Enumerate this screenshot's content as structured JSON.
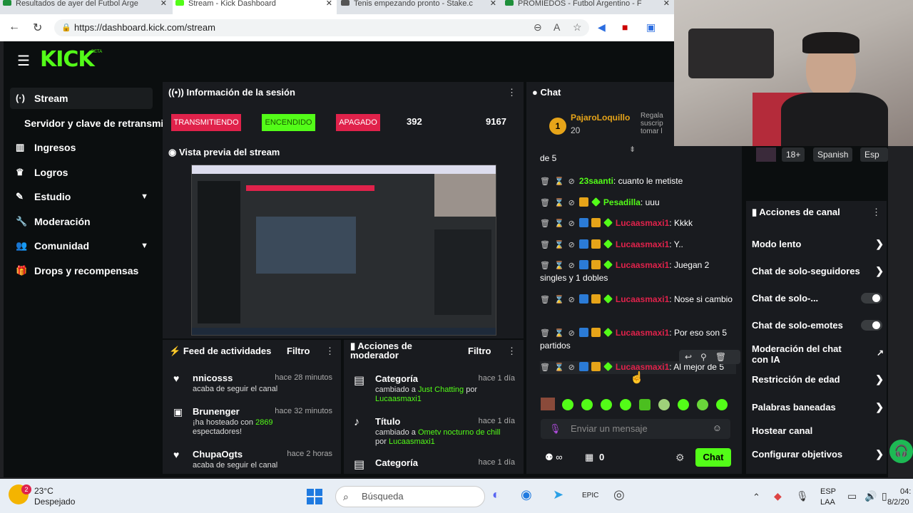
{
  "browser": {
    "tabs": [
      {
        "label": "Resultados de ayer del Futbol Arge"
      },
      {
        "label": "Stream - Kick Dashboard"
      },
      {
        "label": "Tenis empezando pronto - Stake.c"
      },
      {
        "label": "PROMIEDOS - Futbol Argentino - F"
      }
    ],
    "url": "https://dashboard.kick.com/stream"
  },
  "app": {
    "logo": "KICK",
    "beta": "BETA"
  },
  "sidebar": {
    "items": [
      {
        "label": "Stream",
        "icon": "stream-icon"
      },
      {
        "label": "Servidor y clave de retransmisión",
        "icon": ""
      },
      {
        "label": "Ingresos",
        "icon": "bar-chart-icon"
      },
      {
        "label": "Logros",
        "icon": "trophy-icon"
      },
      {
        "label": "Estudio",
        "icon": "brush-icon"
      },
      {
        "label": "Moderación",
        "icon": "wrench-icon"
      },
      {
        "label": "Comunidad",
        "icon": "users-icon"
      },
      {
        "label": "Drops y recompensas",
        "icon": "gift-icon"
      }
    ]
  },
  "session": {
    "title": "Información de la sesión",
    "transmitting": "TRANSMITIENDO",
    "on": "ENCENDIDO",
    "off": "APAGADO",
    "viewers": "392",
    "followers": "9167"
  },
  "preview": {
    "title": "Vista previa del stream"
  },
  "feed": {
    "title": "Feed de actividades",
    "filter": "Filtro",
    "items": [
      {
        "name": "nnicosss",
        "time": "hace 28 minutos",
        "desc": "acaba de seguir el canal"
      },
      {
        "name": "Brunenger",
        "time": "hace 32 minutos",
        "desc_a": "¡ha hosteado con ",
        "desc_num": "2869",
        "desc_b": "espectadores!"
      },
      {
        "name": "ChupaOgts",
        "time": "hace 2 horas",
        "desc": "acaba de seguir el canal"
      }
    ]
  },
  "modactions": {
    "title": "Acciones de moderador",
    "filter": "Filtro",
    "items": [
      {
        "name": "Categoría",
        "time": "hace 1 día",
        "desc_a": "cambiado a ",
        "desc_hl": "Just Chatting",
        "desc_b": " por",
        "user": "Lucaasmaxi1"
      },
      {
        "name": "Título",
        "time": "hace 1 día",
        "desc_a": "cambiado a ",
        "desc_hl": "Ometv nocturno de chill",
        "desc_b": " por",
        "user": "Lucaasmaxi1"
      },
      {
        "name": "Categoría",
        "time": "hace 1 día"
      }
    ]
  },
  "chat": {
    "title": "Chat",
    "pinned_user": "PajaroLoquillo",
    "pinned_count": "20",
    "gift_text": "Regala suscrip tomar l",
    "partial_top": "de 5",
    "messages": [
      {
        "user": "23saanti",
        "text": ": cuanto le metiste",
        "color": "#53fc18"
      },
      {
        "user": "Pesadilla",
        "text": ": uuu",
        "color": "#53fc18"
      },
      {
        "user": "Lucaasmaxi1",
        "text": ": Kkkk",
        "color": "#e0224b"
      },
      {
        "user": "Lucaasmaxi1",
        "text": ": Y..",
        "color": "#e0224b"
      },
      {
        "user": "Lucaasmaxi1",
        "text": ": Juegan 2 singles y 1 dobles",
        "color": "#e0224b"
      },
      {
        "user": "Lucaasmaxi1",
        "text": ": Nose si cambio",
        "color": "#e0224b"
      },
      {
        "user": "Lucaasmaxi1",
        "text": ": Por eso son 5 partidos",
        "color": "#e0224b"
      },
      {
        "user": "Lucaasmaxi1",
        "text": ": Al mejor de 5",
        "color": "#e0224b"
      }
    ],
    "input_placeholder": "Enviar un mensaje",
    "count": "0",
    "send": "Chat"
  },
  "channel": {
    "tags": [
      "18+",
      "Spanish",
      "Esp"
    ],
    "title": "Acciones de canal",
    "actions": [
      {
        "label": "Modo lento",
        "kind": "arrow"
      },
      {
        "label": "Chat de solo-seguidores",
        "kind": "arrow"
      },
      {
        "label": "Chat de solo-...",
        "kind": "toggle"
      },
      {
        "label": "Chat de solo-emotes",
        "kind": "toggle"
      },
      {
        "label": "Moderación del chat con IA",
        "kind": "external"
      },
      {
        "label": "Restricción de edad",
        "kind": "arrow"
      },
      {
        "label": "Palabras baneadas",
        "kind": "arrow"
      },
      {
        "label": "Hostear canal",
        "kind": "none"
      },
      {
        "label": "Configurar objetivos",
        "kind": "arrow"
      }
    ]
  },
  "taskbar": {
    "temp": "23°C",
    "weather": "Despejado",
    "weather_badge": "2",
    "search": "Búsqueda",
    "lang": "ESP",
    "lang2": "LAA",
    "time": "04:",
    "date": "8/2/20"
  },
  "colors": {
    "brand": "#53fc18",
    "danger": "#e0224b",
    "panel": "#191b1f"
  }
}
